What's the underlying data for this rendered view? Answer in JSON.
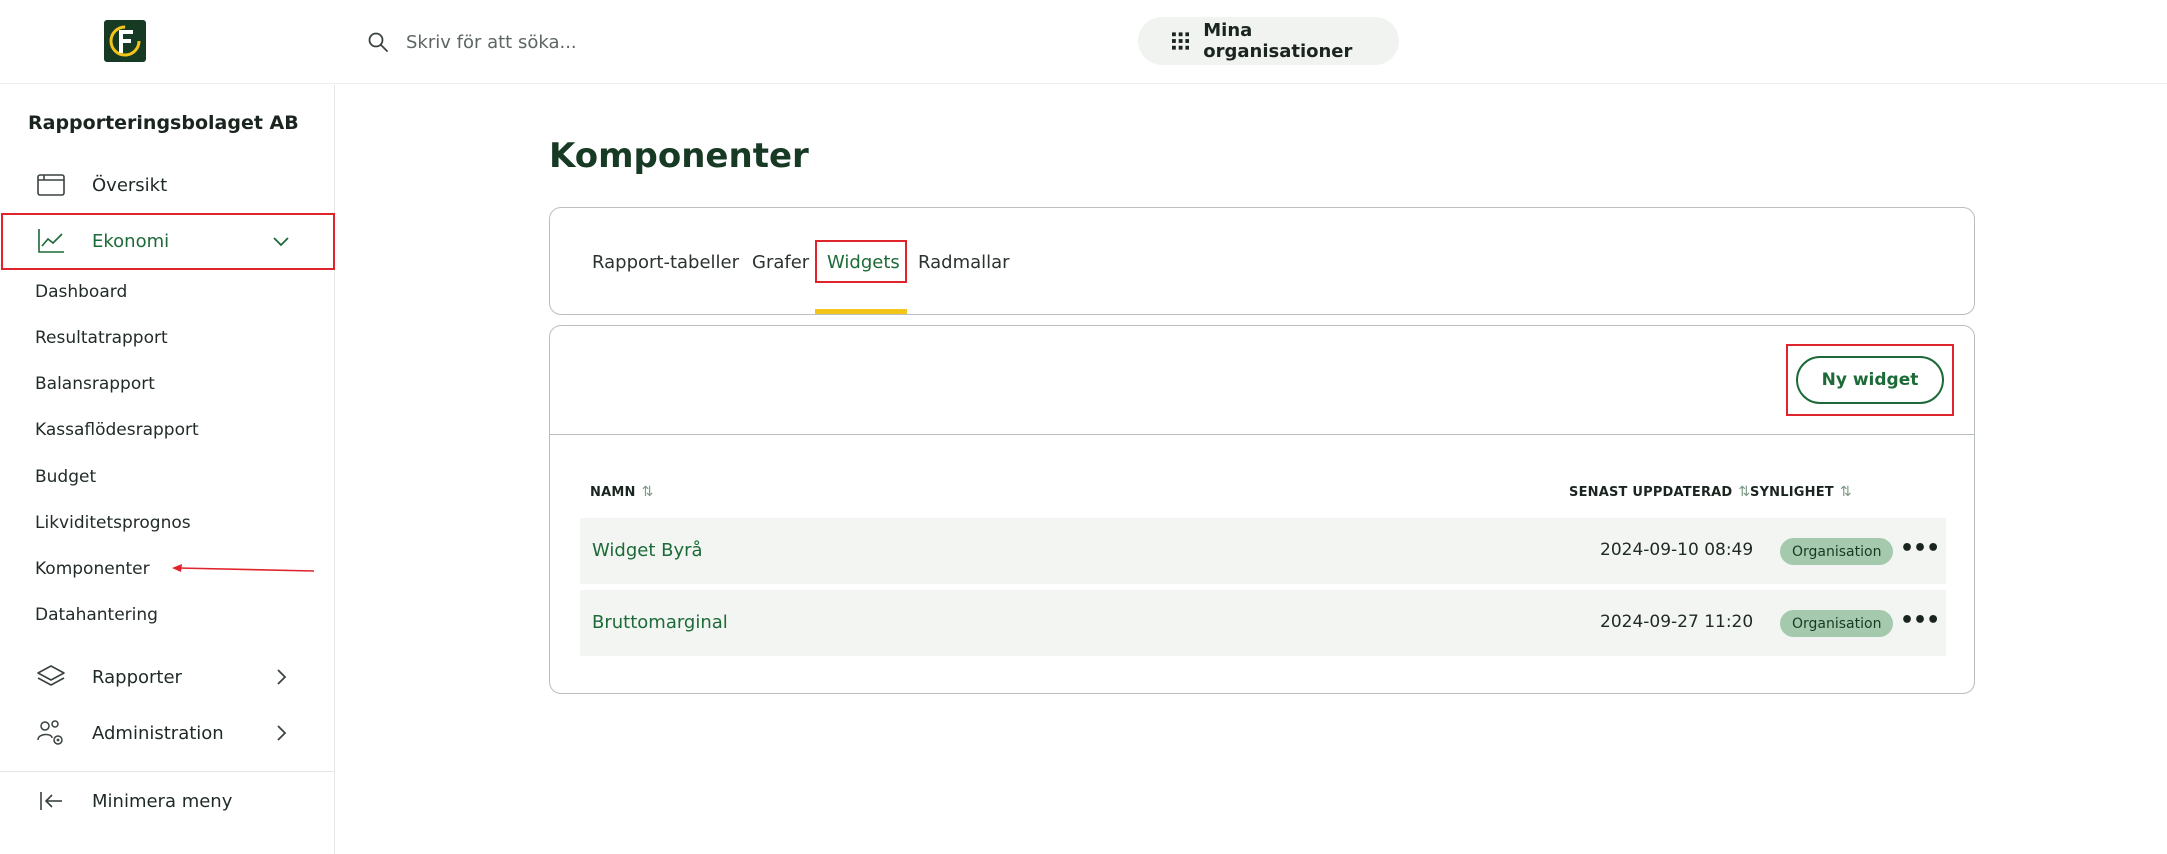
{
  "header": {
    "search_placeholder": "Skriv för att söka...",
    "orgs_label": "Mina organisationer"
  },
  "sidebar": {
    "company": "Rapporteringsbolaget AB",
    "items": [
      {
        "label": "Översikt",
        "icon": "browser-window-icon"
      },
      {
        "label": "Ekonomi",
        "icon": "line-chart-icon"
      },
      {
        "label": "Rapporter",
        "icon": "layers-icon"
      },
      {
        "label": "Administration",
        "icon": "users-gear-icon"
      }
    ],
    "sub_items": [
      "Dashboard",
      "Resultatrapport",
      "Balansrapport",
      "Kassaflödesrapport",
      "Budget",
      "Likviditetsprognos",
      "Komponenter",
      "Datahantering"
    ],
    "minimize_label": "Minimera meny"
  },
  "main": {
    "title": "Komponenter",
    "tabs": [
      "Rapport-tabeller",
      "Grafer",
      "Widgets",
      "Radmallar"
    ],
    "new_button": "Ny widget",
    "columns": {
      "name": "NAMN",
      "updated": "SENAST UPPDATERAD",
      "visibility": "SYNLIGHET"
    },
    "rows": [
      {
        "name": "Widget Byrå",
        "updated": "2024-09-10 08:49",
        "visibility": "Organisation"
      },
      {
        "name": "Bruttomarginal",
        "updated": "2024-09-27 11:20",
        "visibility": "Organisation"
      }
    ]
  },
  "colors": {
    "brand_green": "#1c6a37",
    "dark_green": "#173a24",
    "accent_yellow": "#f3c41a",
    "badge_green": "#a5c9ad",
    "highlight_red": "#e0242b"
  }
}
